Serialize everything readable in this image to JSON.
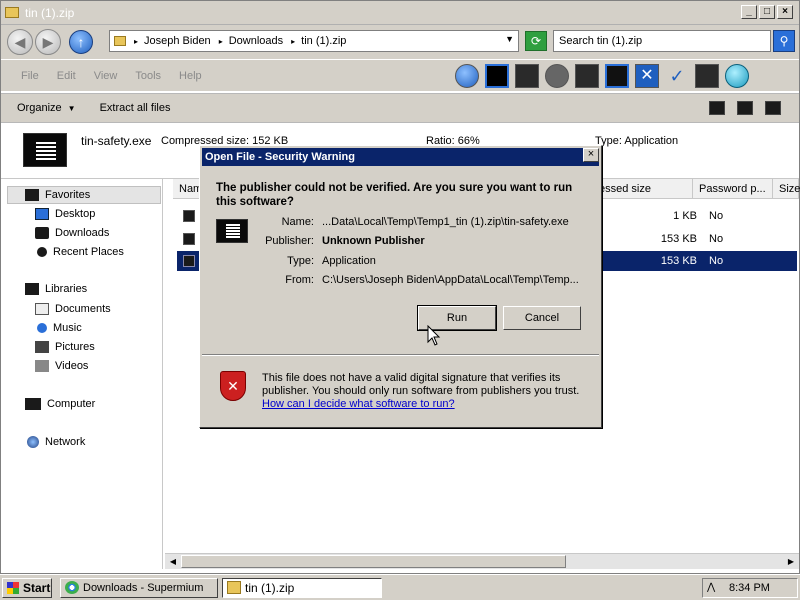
{
  "window": {
    "title": "tin (1).zip"
  },
  "address": {
    "crumbs": [
      "Joseph Biden",
      "Downloads",
      "tin (1).zip"
    ],
    "search_placeholder": "Search tin (1).zip"
  },
  "menu": [
    "File",
    "Edit",
    "View",
    "Tools",
    "Help"
  ],
  "commands": {
    "organize": "Organize",
    "extract": "Extract all files"
  },
  "details": {
    "filename": "tin-safety.exe",
    "compressed_size": "Compressed size: 152 KB",
    "ratio": "Ratio: 66%",
    "type": "Type: Application"
  },
  "sidebar": {
    "favorites": "Favorites",
    "desktop": "Desktop",
    "downloads": "Downloads",
    "recent": "Recent Places",
    "libraries": "Libraries",
    "documents": "Documents",
    "music": "Music",
    "pictures": "Pictures",
    "videos": "Videos",
    "computer": "Computer",
    "network": "Network"
  },
  "table": {
    "headers": [
      "Nam",
      "essed size",
      "Password p...",
      "Size"
    ],
    "rows": [
      {
        "size": "1 KB",
        "password": "No"
      },
      {
        "size": "153 KB",
        "password": "No"
      },
      {
        "size": "153 KB",
        "password": "No"
      }
    ]
  },
  "dialog": {
    "title": "Open File - Security Warning",
    "question": "The publisher could not be verified.  Are you sure you want to run this software?",
    "labels": {
      "name": "Name:",
      "publisher": "Publisher:",
      "type": "Type:",
      "from": "From:"
    },
    "values": {
      "name": "...Data\\Local\\Temp\\Temp1_tin (1).zip\\tin-safety.exe",
      "publisher": "Unknown Publisher",
      "type": "Application",
      "from": "C:\\Users\\Joseph Biden\\AppData\\Local\\Temp\\Temp..."
    },
    "run": "Run",
    "cancel": "Cancel",
    "close": "×",
    "warning": "This file does not have a valid digital signature that verifies its publisher.  You should only run software from publishers you trust.",
    "link": "How can I decide what software to run?"
  },
  "taskbar": {
    "start": "Start",
    "tasks": [
      "Downloads - Supermium",
      "tin (1).zip"
    ],
    "clock": "8:34 PM"
  }
}
